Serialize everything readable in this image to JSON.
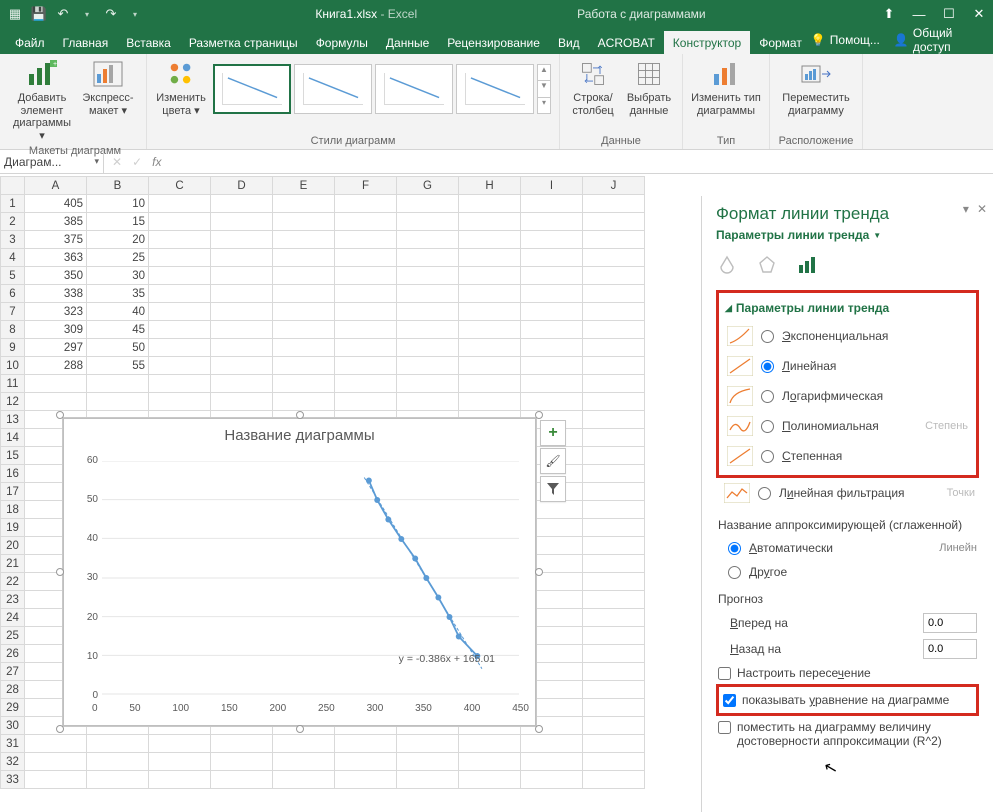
{
  "title": {
    "filename": "Книга1.xlsx",
    "app": " - Excel",
    "context": "Работа с диаграммами"
  },
  "qat": {
    "save": "💾",
    "undo": "↶",
    "redo": "↷"
  },
  "win": {
    "min": "—",
    "max": "☐",
    "close": "✕",
    "user": "⬆"
  },
  "tabs": {
    "file": "Файл",
    "home": "Главная",
    "insert": "Вставка",
    "layout": "Разметка страницы",
    "formulas": "Формулы",
    "data": "Данные",
    "review": "Рецензирование",
    "view": "Вид",
    "acrobat": "ACROBAT",
    "design": "Конструктор",
    "format": "Формат",
    "help_icon": "💡",
    "help": "Помощ...",
    "share_icon": "👤",
    "share": "Общий доступ"
  },
  "ribbon": {
    "add_el": "Добавить элемент диаграммы",
    "express": "Экспресс-макет",
    "g_layouts": "Макеты диаграмм",
    "colors": "Изменить цвета",
    "g_styles": "Стили диаграмм",
    "swap": "Строка/столбец",
    "select": "Выбрать данные",
    "g_data": "Данные",
    "change": "Изменить тип диаграммы",
    "g_type": "Тип",
    "move": "Переместить диаграмму",
    "g_loc": "Расположение"
  },
  "namebox": "Диаграм...",
  "fx": "fx",
  "cols": [
    "A",
    "B",
    "C",
    "D",
    "E",
    "F",
    "G",
    "H",
    "I",
    "J"
  ],
  "rows": [
    {
      "r": 1,
      "a": 405,
      "b": 10
    },
    {
      "r": 2,
      "a": 385,
      "b": 15
    },
    {
      "r": 3,
      "a": 375,
      "b": 20
    },
    {
      "r": 4,
      "a": 363,
      "b": 25
    },
    {
      "r": 5,
      "a": 350,
      "b": 30
    },
    {
      "r": 6,
      "a": 338,
      "b": 35
    },
    {
      "r": 7,
      "a": 323,
      "b": 40
    },
    {
      "r": 8,
      "a": 309,
      "b": 45
    },
    {
      "r": 9,
      "a": 297,
      "b": 50
    },
    {
      "r": 10,
      "a": 288,
      "b": 55
    }
  ],
  "empty_rows": [
    11,
    12,
    13,
    14,
    15,
    16,
    17,
    18,
    19,
    20,
    21,
    22,
    23,
    24,
    25,
    26,
    27,
    28,
    29,
    30,
    31,
    32,
    33
  ],
  "chart": {
    "title": "Название диаграммы",
    "equation": "y = -0.386x + 165.01"
  },
  "chart_data": {
    "type": "scatter",
    "xlabel": "",
    "ylabel": "",
    "xlim": [
      0,
      450
    ],
    "ylim": [
      0,
      60
    ],
    "xticks": [
      0,
      50,
      100,
      150,
      200,
      250,
      300,
      350,
      400,
      450
    ],
    "yticks": [
      0,
      10,
      20,
      30,
      40,
      50,
      60
    ],
    "series": [
      {
        "name": "",
        "x": [
          405,
          385,
          375,
          363,
          350,
          338,
          323,
          309,
          297,
          288
        ],
        "y": [
          10,
          15,
          20,
          25,
          30,
          35,
          40,
          45,
          50,
          55
        ]
      }
    ],
    "trendline": {
      "type": "linear",
      "equation": "y = -0.386x + 165.01",
      "slope": -0.386,
      "intercept": 165.01
    }
  },
  "sidebtns": {
    "plus": "+",
    "brush": "🖌",
    "filter": "▾"
  },
  "pane": {
    "title": "Формат линии тренда",
    "subtitle": "Параметры линии тренда",
    "section": "Параметры линии тренда",
    "opts": {
      "exp": "Экспоненциальная",
      "lin": "Линейная",
      "log": "Логарифмическая",
      "poly": "Полиномиальная",
      "pow": "Степенная",
      "ma": "Линейная фильтрация",
      "poly_lbl": "Степень",
      "ma_lbl": "Точки"
    },
    "name_hdr": "Название аппроксимирующей (сглаженной)",
    "name_auto": "Автоматически",
    "name_auto_val": "Линейн",
    "name_other": "Другое",
    "forecast": "Прогноз",
    "fwd": "Вперед на",
    "bwd": "Назад на",
    "fwd_v": "0.0",
    "bwd_v": "0.0",
    "intercept": "Настроить пересечение",
    "show_eq": "показывать уравнение на диаграмме",
    "show_r2": "поместить на диаграмму величину достоверности аппроксимации (R^2)"
  }
}
